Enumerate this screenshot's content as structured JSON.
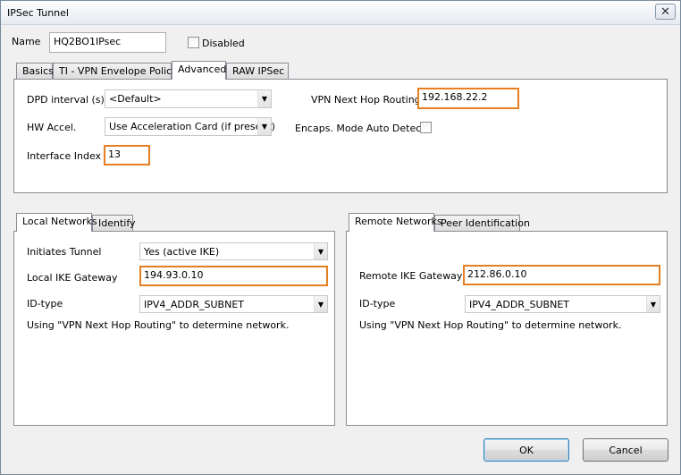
{
  "window": {
    "title": "IPSec Tunnel"
  },
  "name_row": {
    "label": "Name",
    "value": "HQ2BO1IPsec",
    "disabled_label": "Disabled",
    "disabled_checked": false
  },
  "top_tabs": [
    "Basics",
    "TI - VPN Envelope Policy",
    "Advanced",
    "RAW IPSec"
  ],
  "advanced": {
    "dpd_label": "DPD interval (s)",
    "dpd_value": "<Default>",
    "hw_label": "HW Accel.",
    "hw_value": "Use Acceleration Card (if present)",
    "iface_label": "Interface Index",
    "iface_value": "13",
    "vpn_hop_label": "VPN Next Hop Routing",
    "vpn_hop_value": "192.168.22.2",
    "encaps_label": "Encaps. Mode Auto Detec.",
    "encaps_checked": false
  },
  "local": {
    "tabs": [
      "Local Networks",
      "Identify"
    ],
    "initiates_label": "Initiates Tunnel",
    "initiates_value": "Yes (active IKE)",
    "gateway_label": "Local IKE Gateway",
    "gateway_value": "194.93.0.10",
    "idtype_label": "ID-type",
    "idtype_value": "IPV4_ADDR_SUBNET",
    "note": "Using \"VPN Next Hop Routing\" to determine network."
  },
  "remote": {
    "tabs": [
      "Remote Networks",
      "Peer Identification"
    ],
    "gateway_label": "Remote IKE Gateway",
    "gateway_value": "212.86.0.10",
    "idtype_label": "ID-type",
    "idtype_value": "IPV4_ADDR_SUBNET",
    "note": "Using \"VPN Next Hop Routing\" to determine network."
  },
  "buttons": {
    "ok": "OK",
    "cancel": "Cancel"
  },
  "colors": {
    "highlight": "#e67e22",
    "window_bg": "#f0f0f0"
  }
}
